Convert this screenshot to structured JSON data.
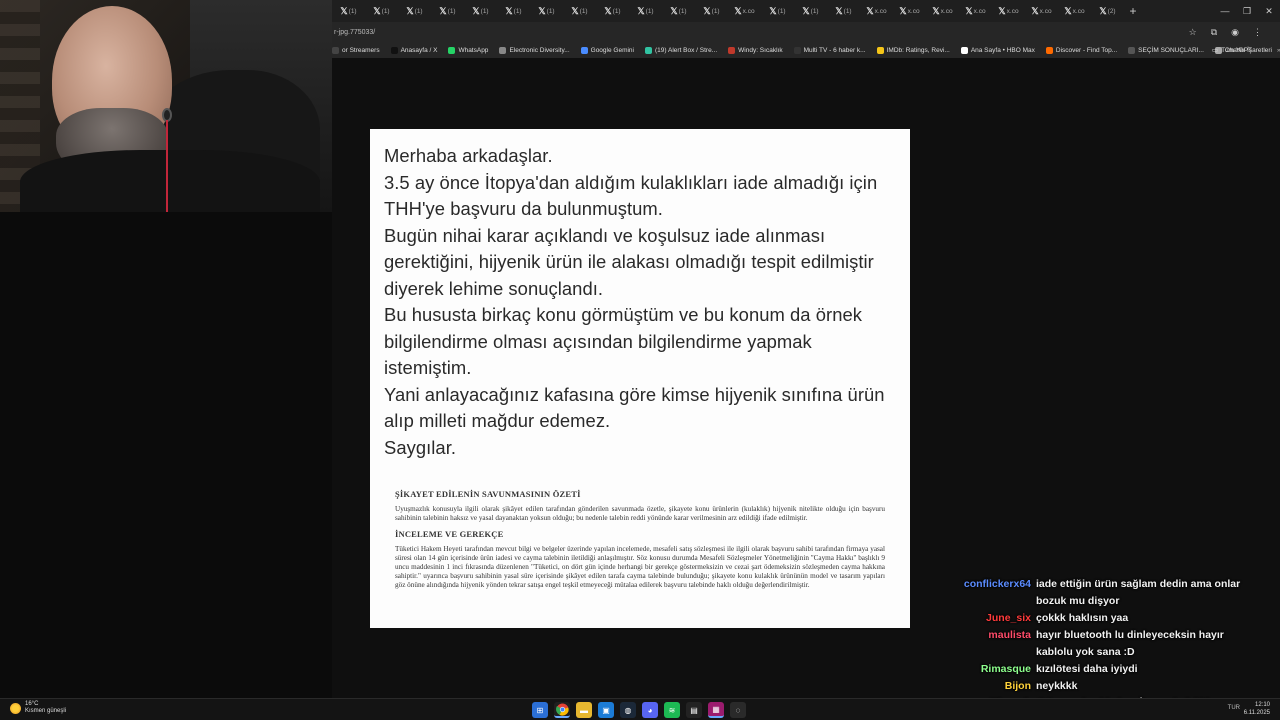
{
  "browser": {
    "tabs": [
      {
        "icon": "x-icon",
        "label": "(1)"
      },
      {
        "icon": "x-icon",
        "label": "(1)"
      },
      {
        "icon": "x-icon",
        "label": "(1)"
      },
      {
        "icon": "x-icon",
        "label": "(1)"
      },
      {
        "icon": "x-icon",
        "label": "(1)"
      },
      {
        "icon": "x-icon",
        "label": "(1)"
      },
      {
        "icon": "x-icon",
        "label": "(1)"
      },
      {
        "icon": "x-icon",
        "label": "(1)"
      },
      {
        "icon": "x-icon",
        "label": "(1)"
      },
      {
        "icon": "x-icon",
        "label": "(1)"
      },
      {
        "icon": "x-icon",
        "label": "(1)"
      },
      {
        "icon": "x-icon",
        "label": "(1)"
      },
      {
        "icon": "x-icon",
        "label": "x.co"
      },
      {
        "icon": "x-icon",
        "label": "(1)"
      },
      {
        "icon": "x-icon",
        "label": "(1)"
      },
      {
        "icon": "x-icon",
        "label": "(1)"
      },
      {
        "icon": "x-icon",
        "label": "x.co"
      },
      {
        "icon": "x-icon",
        "label": "x.co"
      },
      {
        "icon": "x-icon",
        "label": "x.co"
      },
      {
        "icon": "x-icon",
        "label": "x.co"
      },
      {
        "icon": "x-icon",
        "label": "x.co"
      },
      {
        "icon": "x-icon",
        "label": "x.co"
      },
      {
        "icon": "x-icon",
        "label": "x.co"
      },
      {
        "icon": "x-icon",
        "label": "(2)"
      }
    ],
    "url": "r-jpg.775033/",
    "bookmarks": [
      {
        "label": "or Streamers",
        "color": "#444"
      },
      {
        "label": "Anasayfa / X",
        "color": "#111"
      },
      {
        "label": "WhatsApp",
        "color": "#25d366"
      },
      {
        "label": "Electronic Diversity...",
        "color": "#888"
      },
      {
        "label": "Google Gemini",
        "color": "#4a8cff"
      },
      {
        "label": "(19) Alert Box / Stre...",
        "color": "#31c3a2"
      },
      {
        "label": "Windy: Sıcaklık",
        "color": "#c0392b"
      },
      {
        "label": "Multi TV - 6 haber k...",
        "color": "#333"
      },
      {
        "label": "IMDb: Ratings, Revi...",
        "color": "#f5c518"
      },
      {
        "label": "Ana Sayfa • HBO Max",
        "color": "#fff"
      },
      {
        "label": "Discover - Find Top...",
        "color": "#ff6a00"
      },
      {
        "label": "SEÇİM SONUÇLARI...",
        "color": "#555"
      },
      {
        "label": "ChatGPT",
        "color": "#aaa"
      }
    ],
    "bookmarks_all": "Tüm Yer İşaretleri"
  },
  "message": {
    "lines": [
      "Merhaba arkadaşlar.",
      "3.5 ay önce İtopya'dan aldığım kulaklıkları iade almadığı için THH'ye başvuru da bulunmuştum.",
      "Bugün nihai karar açıklandı ve koşulsuz iade alınması gerektiğini, hijyenik ürün ile alakası olmadığı tespit edilmiştir diyerek lehime sonuçlandı.",
      "Bu hususta birkaç konu görmüştüm ve bu konum da örnek bilgilendirme olması açısından bilgilendirme yapmak istemiştim.",
      "Yani anlayacağınız kafasına göre kimse hijyenik sınıfına ürün alıp milleti mağdur edemez.",
      "Saygılar."
    ]
  },
  "document": {
    "heading1": "ŞİKAYET EDİLENİN SAVUNMASININ ÖZETİ",
    "para1": "Uyuşmazlık konusuyla ilgili olarak şikâyet edilen tarafından gönderilen savunmada özetle, şikayete konu ürünlerin (kulaklık) hijyenik nitelikte olduğu için başvuru sahibinin talebinin haksız ve yasal dayanaktan yoksun olduğu; bu nedenle talebin reddi yönünde karar verilmesinin arz edildiği ifade edilmiştir.",
    "heading2": "İNCELEME VE GEREKÇE",
    "para2": "Tüketici Hakem Heyeti tarafından mevcut bilgi ve belgeler üzerinde yapılan incelemede, mesafeli satış sözleşmesi ile ilgili olarak başvuru sahibi tarafından firmaya yasal süresi olan 14 gün içerisinde ürün iadesi ve cayma talebinin iletildiği anlaşılmıştır. Söz konusu durumda Mesafeli Sözleşmeler Yönetmeliğinin ''Cayma Hakkı'' başlıklı 9 uncu maddesinin 1 inci fıkrasında düzenlenen \"Tüketici, on dört gün içinde herhangi bir gerekçe göstermeksizin ve cezai şart ödemeksizin sözleşmeden cayma hakkına sahiptir.\" uyarınca başvuru sahibinin yasal süre içerisinde şikâyet edilen tarafa cayma talebinde bulunduğu; şikayete konu kulaklık ürününün model ve tasarım yapıları göz önüne alındığında hijyenik yönden tekrar satışa engel teşkil etmeyeceği mütalaa edilerek başvuru talebinde haklı olduğu değerlendirilmiştir."
  },
  "chat": [
    {
      "user": "conflickerx64",
      "color": "#5b8cff",
      "text": "iade ettiğin ürün sağlam dedin ama onlar bozuk mu dişyor"
    },
    {
      "user": "June_six",
      "color": "#ff3b3b",
      "text": "çokkk haklısın yaa"
    },
    {
      "user": "maulista",
      "color": "#ff4c6a",
      "text": "hayır bluetooth lu dinleyeceksin hayır kablolu yok sana :D"
    },
    {
      "user": "Rimasque",
      "color": "#8eff8e",
      "text": "kızılötesi daha iyiydi"
    },
    {
      "user": "Bijon",
      "color": "#ffd23a",
      "text": "neykkkk"
    },
    {
      "user": "Riaxaph",
      "color": "#7fd0ff",
      "text": "@June_six abla boş İtem o kulaklık ya..s"
    }
  ],
  "taskbar": {
    "weather_temp": "16°C",
    "weather_desc": "Kısmen güneşli",
    "lang": "TUR",
    "time": "12:10",
    "date": "6.11.2025"
  }
}
